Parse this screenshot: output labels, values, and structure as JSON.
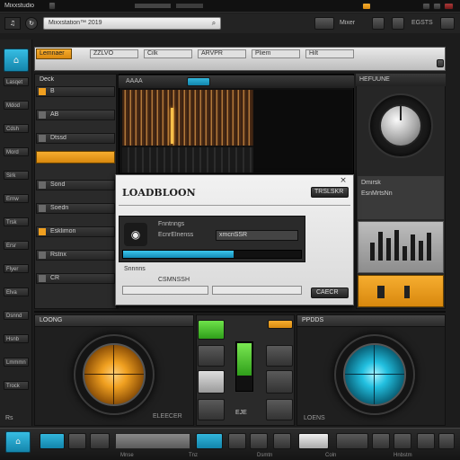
{
  "window": {
    "title": "Mixxstudio"
  },
  "topbar": {
    "search_value": "Mixxstation™ 2019",
    "search_placeholder": "",
    "right_label": "Mixer",
    "status_text": "EGSTS"
  },
  "toolbar": {
    "tab_label": "Lemnaer",
    "items": [
      "ZZLVO",
      "Cilk",
      "ARVPR",
      "Pliem",
      "Hilt"
    ]
  },
  "sidebar": {
    "items": [
      "Lasqet",
      "Mdod",
      "Cdsh",
      "Mord",
      "Sirk",
      "Ernw",
      "Trsk",
      "Ersr",
      "Flyer",
      "Elva",
      "Dsnnd",
      "Hsnb",
      "Lmmmn",
      "Trock"
    ],
    "bottom_label": "Rs"
  },
  "left_list": {
    "header": "Deck",
    "rows": [
      "B",
      "AB",
      "Dtssd",
      "Loch",
      "Sond",
      "Soedn",
      "Esklimon",
      "Rstnx",
      "CR"
    ]
  },
  "waveform": {
    "label": "AAAA"
  },
  "right_panel": {
    "header": "HEFUUNE",
    "rows": [
      "Dmirsk",
      "EsnMrtsNn"
    ],
    "level_values": [
      0.55,
      0.9,
      0.7,
      0.95,
      0.45,
      0.8,
      0.6,
      0.85
    ]
  },
  "dialog": {
    "title": "LOADBLOON",
    "close_glyph": "×",
    "ok_label": "TRSLSKR",
    "cancel_label": "CAECR",
    "rows": [
      "Fnntnngs",
      "EcnrElnenss",
      "Snnnns",
      "CSMNSSH"
    ],
    "input_value": "xmcnSSR",
    "progress": 0.62
  },
  "decks": {
    "left_title": "LOONG",
    "left_footer": "ELEECER",
    "right_title": "PPDDS",
    "right_footer": "LOENS"
  },
  "center_strip": {
    "badge": "EJE"
  },
  "bottom_bar": {
    "items": [
      "Mnse",
      "Tnz",
      "Dsmtn",
      "Coln",
      "Hnbstm"
    ]
  },
  "colors": {
    "orange": "#f0a020",
    "cyan": "#22aed6",
    "green": "#5ad23a",
    "bg": "#1c1c1c"
  }
}
